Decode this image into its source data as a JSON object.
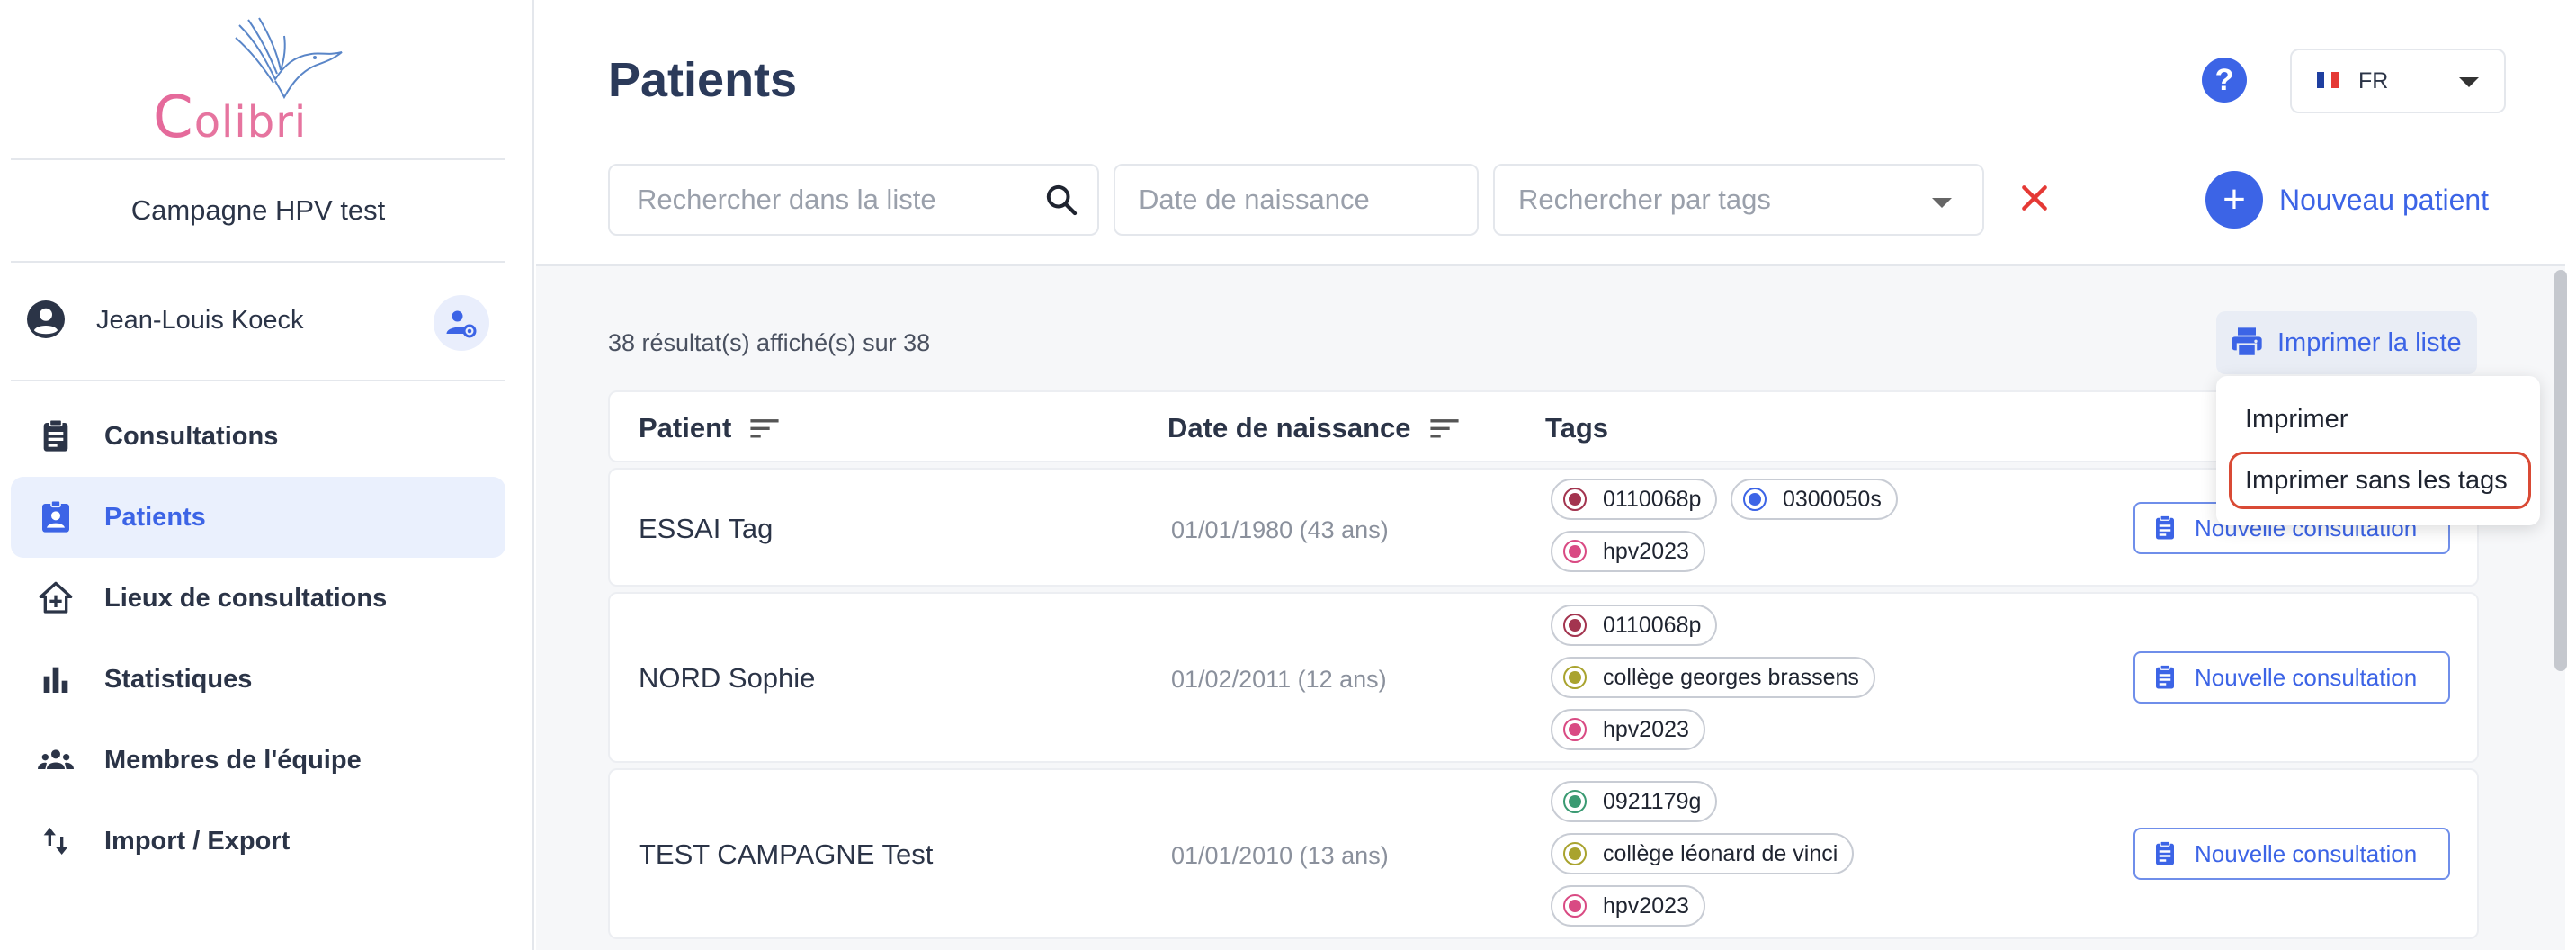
{
  "app": {
    "logo_text": "olibri",
    "logo_initial": "C"
  },
  "sidebar": {
    "campaign": "Campagne HPV test",
    "user": {
      "name": "Jean-Louis Koeck"
    },
    "items": [
      {
        "label": "Consultations",
        "icon": "clipboard-icon",
        "active": false
      },
      {
        "label": "Patients",
        "icon": "patient-badge-icon",
        "active": true
      },
      {
        "label": "Lieux de consultations",
        "icon": "home-plus-icon",
        "active": false
      },
      {
        "label": "Statistiques",
        "icon": "bar-chart-icon",
        "active": false
      },
      {
        "label": "Membres de l'équipe",
        "icon": "team-icon",
        "active": false
      },
      {
        "label": "Import / Export",
        "icon": "swap-vertical-icon",
        "active": false
      }
    ]
  },
  "header": {
    "title": "Patients",
    "help": "?",
    "language": "FR"
  },
  "filters": {
    "search_placeholder": "Rechercher dans la liste",
    "dob_placeholder": "Date de naissance",
    "tags_placeholder": "Rechercher par tags",
    "new_patient_label": "Nouveau patient"
  },
  "results_text": "38 résultat(s) affiché(s) sur 38",
  "print": {
    "label": "Imprimer la liste",
    "menu": [
      "Imprimer",
      "Imprimer sans les tags"
    ]
  },
  "table": {
    "columns": [
      "Patient",
      "Date de naissance",
      "Tags"
    ],
    "rows": [
      {
        "name": "ESSAI Tag",
        "dob": "01/01/1980 (43 ans)",
        "tags": [
          {
            "label": "0110068p",
            "color": "#a3344f"
          },
          {
            "label": "0300050s",
            "color": "#3c64e6"
          },
          {
            "label": "hpv2023",
            "color": "#d94a83"
          }
        ],
        "action": "Nouvelle consultation"
      },
      {
        "name": "NORD Sophie",
        "dob": "01/02/2011 (12 ans)",
        "tags": [
          {
            "label": "0110068p",
            "color": "#a3344f"
          },
          {
            "label": "collège georges brassens",
            "color": "#a9a32e"
          },
          {
            "label": "hpv2023",
            "color": "#d94a83"
          }
        ],
        "action": "Nouvelle consultation"
      },
      {
        "name": "TEST CAMPAGNE Test",
        "dob": "01/01/2010 (13 ans)",
        "tags": [
          {
            "label": "0921179g",
            "color": "#3a9a72"
          },
          {
            "label": "collège léonard de vinci",
            "color": "#a9a32e"
          },
          {
            "label": "hpv2023",
            "color": "#d94a83"
          }
        ],
        "action": "Nouvelle consultation"
      }
    ]
  },
  "colors": {
    "accent": "#3c64e6",
    "danger": "#e53935",
    "highlight": "#d94a35"
  }
}
